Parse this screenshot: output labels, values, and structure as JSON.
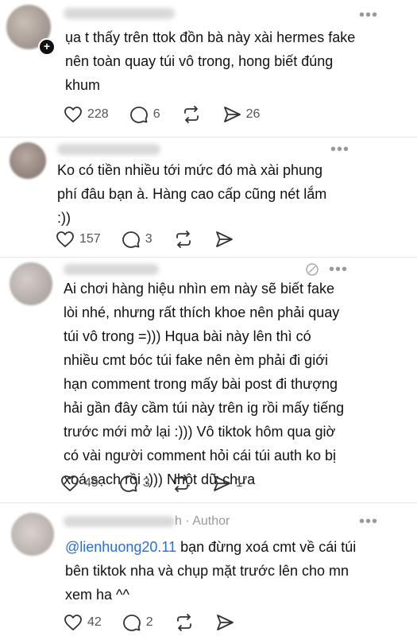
{
  "posts": [
    {
      "text": "ụa t thấy trên ttok đồn bà này xài hermes fake nên toàn quay túi vô trong, hong biết đúng khum",
      "likes": "228",
      "comments": "6",
      "shares": "26",
      "reposts": ""
    },
    {
      "text": "Ko có tiền nhiều tới mức đó mà xài phung phí đâu bạn à. Hàng cao cấp cũng nét lắm :))",
      "likes": "157",
      "comments": "3",
      "shares": "",
      "reposts": ""
    },
    {
      "text": "Ai chơi hàng hiệu nhìn em này sẽ biết fake lòi nhé, nhưng rất thích khoe nên phải quay túi vô trong =))) Hqua bài này lên thì có nhiều cmt bóc túi fake nên èm phải đi giới hạn comment trong mấy bài post đi thượng hải gần đây cầm túi này trên ig rồi mấy tiếng trước mới mở lại :))) Vô tiktok hôm qua giờ có vài người comment hỏi cái túi auth ko bị xoá sạch rồi :))) Nhột dữ chưa",
      "likes": "49",
      "comments": "3",
      "shares": "1",
      "reposts": ""
    },
    {
      "author_label": "h · Author",
      "mention": "@lienhuong20.11",
      "text": " bạn đừng xoá cmt về cái túi bên tiktok nha và chụp mặt trước lên cho mn xem ha ^^",
      "likes": "42",
      "comments": "2",
      "shares": "",
      "reposts": ""
    }
  ],
  "icons": {
    "like": "heart-icon",
    "comment": "comment-bubble-icon",
    "repost": "repost-arrows-icon",
    "share": "send-arrow-icon",
    "more": "more-dots-icon",
    "plus": "follow-plus-icon"
  },
  "more_glyph": "•••",
  "plus_glyph": "+"
}
